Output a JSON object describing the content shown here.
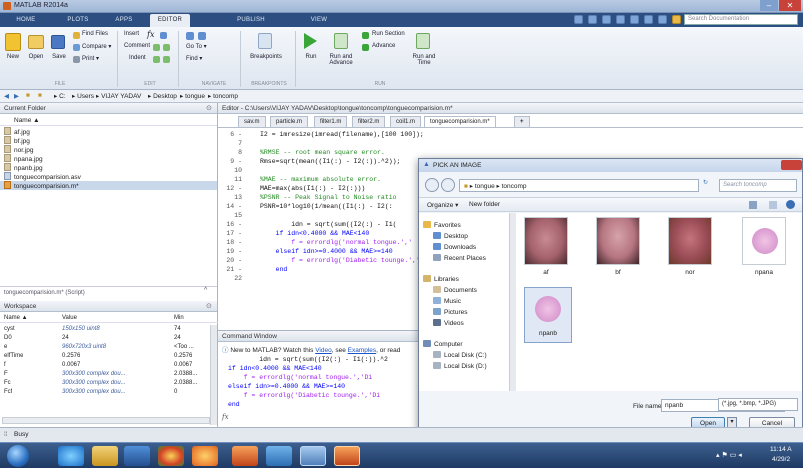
{
  "window": {
    "title": "MATLAB R2014a",
    "min": "–",
    "close": "✕"
  },
  "ribbon_tabs": [
    {
      "label": "HOME"
    },
    {
      "label": "PLOTS"
    },
    {
      "label": "APPS"
    },
    {
      "label": "EDITOR"
    },
    {
      "label": "PUBLISH"
    },
    {
      "label": "VIEW"
    }
  ],
  "search_doc": {
    "placeholder": "Search Documentation"
  },
  "ribbon": {
    "file": {
      "new": "New",
      "open": "Open",
      "save": "Save",
      "find_files": "Find Files",
      "compare": "Compare ▾",
      "print": "Print ▾",
      "section": "FILE"
    },
    "edit": {
      "insert": "Insert",
      "fx": "fx",
      "comment": "Comment",
      "indent": "Indent",
      "section": "EDIT"
    },
    "navigate": {
      "goto": "Go To ▾",
      "find": "Find ▾",
      "section": "NAVIGATE"
    },
    "breakpoints": {
      "label": "Breakpoints",
      "section": "BREAKPOINTS"
    },
    "run": {
      "run": "Run",
      "run_advance": "Run and Advance",
      "run_section": "Run Section",
      "advance": "Advance",
      "run_time": "Run and Time",
      "section": "RUN"
    }
  },
  "address": {
    "path": [
      "C:",
      "Users",
      "VIJAY YADAV",
      "Desktop",
      "tongue",
      "toncomp"
    ]
  },
  "current_folder": {
    "title": "Current Folder",
    "col_name": "Name ▲",
    "files": [
      {
        "name": "af.jpg"
      },
      {
        "name": "bf.jpg"
      },
      {
        "name": "nor.jpg"
      },
      {
        "name": "npana.jpg"
      },
      {
        "name": "npanb.jpg"
      },
      {
        "name": "tonguecomparision.asv"
      },
      {
        "name": "tonguecomparision.m*"
      }
    ],
    "footer": "tonguecomparision.m* (Script)"
  },
  "workspace": {
    "title": "Workspace",
    "cols": [
      "Name ▲",
      "Value",
      "Min"
    ],
    "rows": [
      [
        "cyst",
        "150x150 uint8",
        "74"
      ],
      [
        "D0",
        "24",
        "24"
      ],
      [
        "e",
        "960x720x3 uint8",
        "<Too ..."
      ],
      [
        "elfTime",
        "0.2576",
        "0.2576"
      ],
      [
        "f",
        "0.0067",
        "0.0067"
      ],
      [
        "F",
        "300x300 complex dou...",
        "2.0388..."
      ],
      [
        "Fc",
        "300x300 complex dou...",
        "2.0388..."
      ],
      [
        "Fcf",
        "300x300 complex dou...",
        "0"
      ]
    ]
  },
  "editor": {
    "title": "Editor - C:\\Users\\VIJAY YADAV\\Desktop\\tongue\\toncomp\\tonguecomparision.m*",
    "tabs": [
      {
        "label": "sav.m"
      },
      {
        "label": "particle.m"
      },
      {
        "label": "filter1.m"
      },
      {
        "label": "filter2.m"
      },
      {
        "label": "coil1.m"
      },
      {
        "label": "tonguecomparision.m*"
      }
    ],
    "add_tab": "+",
    "lines": [
      {
        "n": "6 -",
        "c": "I2 = imresize(imread(filename),[100 100]);"
      },
      {
        "n": "7",
        "c": ""
      },
      {
        "n": "8",
        "c": "%RMSE -- root mean square error."
      },
      {
        "n": "9 -",
        "c": "Rmse=sqrt(mean((I1(:) - I2(:)).^2));"
      },
      {
        "n": "10",
        "c": ""
      },
      {
        "n": "11",
        "c": "%MAE -- maximum absolute error."
      },
      {
        "n": "12 -",
        "c": "MAE=max(abs(I1(:) - I2(:)))"
      },
      {
        "n": "13",
        "c": "%PSNR -- Peak Signal to Noise ratio"
      },
      {
        "n": "14 -",
        "c": "PSNR=10*log10(1/mean((I1(:) - I2(:"
      },
      {
        "n": "15",
        "c": ""
      },
      {
        "n": "16 -",
        "c": "        idn = sqrt(sum((I2(:) - I1("
      },
      {
        "n": "17 -",
        "c": "    if idn<0.4000 && MAE<140"
      },
      {
        "n": "18 -",
        "c": "        f = errordlg('normal tongue.','"
      },
      {
        "n": "19 -",
        "c": "    elseif idn>=0.4000 && MAE>=140"
      },
      {
        "n": "20 -",
        "c": "        f = errordlg('Diabetic tounge.','"
      },
      {
        "n": "21 -",
        "c": "    end"
      },
      {
        "n": "22",
        "c": ""
      }
    ]
  },
  "command_window": {
    "title": "Command Window",
    "notice_prefix": "New to MATLAB? Watch this ",
    "video": "Video",
    "see": ", see ",
    "examples": "Examples",
    "or_read": ", or read ",
    "lines": [
      "        idn = sqrt(sum((I2(:) - I1(:)).^2",
      "if idn<0.4000 && MAE<140",
      "    f = errordlg('normal tongue.','Di",
      "elseif idn>=0.4000 && MAE>=140",
      "    f = errordlg('Diabetic tounge.','Di",
      "end"
    ],
    "prompt": "fx"
  },
  "dialog": {
    "title": "PICK AN IMAGE",
    "path": [
      "tongue",
      "toncomp"
    ],
    "search_placeholder": "Search toncomp",
    "organize": "Organize ▾",
    "new_folder": "New folder",
    "nav": [
      {
        "label": "Favorites"
      },
      {
        "label": "Desktop"
      },
      {
        "label": "Downloads"
      },
      {
        "label": "Recent Places"
      },
      {
        "label": "Libraries"
      },
      {
        "label": "Documents"
      },
      {
        "label": "Music"
      },
      {
        "label": "Pictures"
      },
      {
        "label": "Videos"
      },
      {
        "label": "Computer"
      },
      {
        "label": "Local Disk (C:)"
      },
      {
        "label": "Local Disk (D:)"
      }
    ],
    "files": [
      {
        "label": "af"
      },
      {
        "label": "bf"
      },
      {
        "label": "nor"
      },
      {
        "label": "npana"
      },
      {
        "label": "npanb"
      }
    ],
    "filename_label": "File name:",
    "filename": "npanb",
    "filter": "(*.jpg, *.bmp, *.JPG)",
    "open": "Open",
    "cancel": "Cancel"
  },
  "status": {
    "text": "Busy"
  },
  "clock": {
    "time": "11:14 A",
    "date": "4/29/2"
  },
  "colors": {
    "ribbon_blue": "#2d4e80",
    "taskbar": "#1e3a63",
    "editor_comment": "#228b22",
    "string": "#a020f0"
  }
}
